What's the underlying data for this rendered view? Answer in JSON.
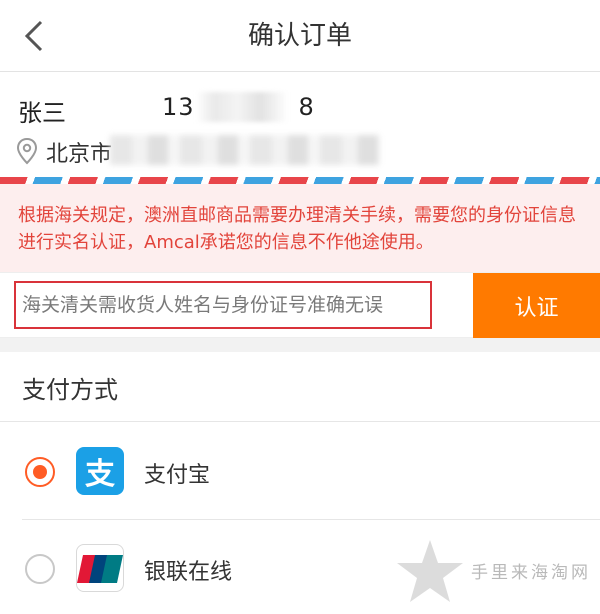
{
  "header": {
    "title": "确认订单",
    "back_icon": "chevron-left-icon"
  },
  "address": {
    "name": "张三",
    "phone_visible": "13",
    "phone_tail": "8",
    "detail_visible": "北京市",
    "pin_icon": "location-pin-icon",
    "chevron_icon": "chevron-right-icon"
  },
  "notice": {
    "text": "根据海关规定，澳洲直邮商品需要办理清关手续，需要您的身份证信息进行实名认证，Amcal承诺您的信息不作他途使用。",
    "color": "#e2443b",
    "background": "#fdeeee"
  },
  "id_verify": {
    "placeholder": "海关清关需收货人姓名与身份证号准确无误",
    "value": "",
    "button_label": "认证",
    "button_color": "#ff7a00"
  },
  "payment": {
    "section_title": "支付方式",
    "options": [
      {
        "label": "支付宝",
        "icon": "alipay-logo-icon",
        "selected": true
      },
      {
        "label": "银联在线",
        "icon": "unionpay-logo-icon",
        "selected": false
      }
    ],
    "accent_color": "#ff5c25"
  },
  "watermark": {
    "text": "手里来海淘网",
    "icon": "star-icon"
  }
}
